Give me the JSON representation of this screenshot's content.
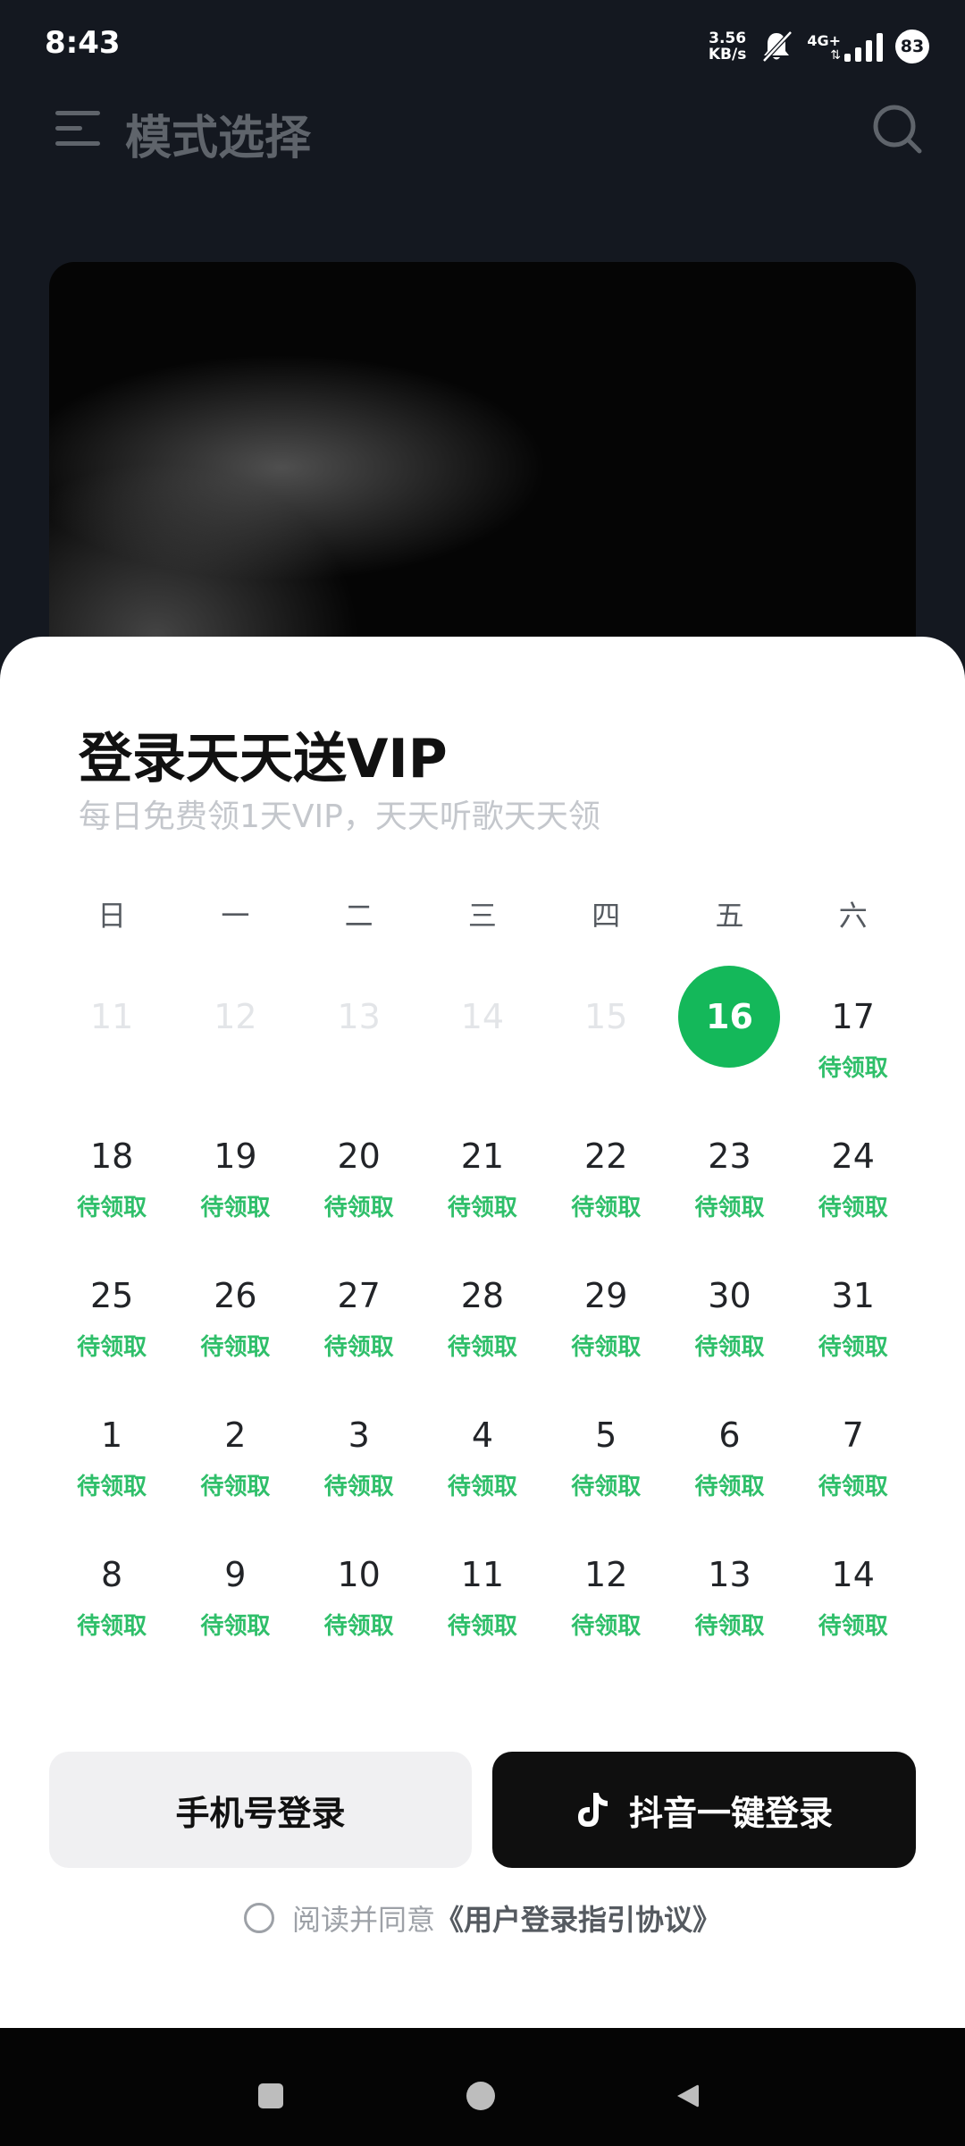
{
  "status_bar": {
    "time": "8:43",
    "net_speed_value": "3.56",
    "net_speed_unit": "KB/s",
    "network_type": "4G+",
    "battery": "83"
  },
  "header": {
    "title": "模式选择",
    "menu_icon": "menu-icon",
    "search_icon": "search-icon"
  },
  "sheet": {
    "title": "登录天天送VIP",
    "subtitle": "每日免费领1天VIP，天天听歌天天领",
    "weekdays": [
      "日",
      "一",
      "二",
      "三",
      "四",
      "五",
      "六"
    ],
    "days": [
      {
        "num": "11",
        "state": "past",
        "tag": ""
      },
      {
        "num": "12",
        "state": "past",
        "tag": ""
      },
      {
        "num": "13",
        "state": "past",
        "tag": ""
      },
      {
        "num": "14",
        "state": "past",
        "tag": ""
      },
      {
        "num": "15",
        "state": "past",
        "tag": ""
      },
      {
        "num": "16",
        "state": "today",
        "tag": ""
      },
      {
        "num": "17",
        "state": "future",
        "tag": "待领取"
      },
      {
        "num": "18",
        "state": "future",
        "tag": "待领取"
      },
      {
        "num": "19",
        "state": "future",
        "tag": "待领取"
      },
      {
        "num": "20",
        "state": "future",
        "tag": "待领取"
      },
      {
        "num": "21",
        "state": "future",
        "tag": "待领取"
      },
      {
        "num": "22",
        "state": "future",
        "tag": "待领取"
      },
      {
        "num": "23",
        "state": "future",
        "tag": "待领取"
      },
      {
        "num": "24",
        "state": "future",
        "tag": "待领取"
      },
      {
        "num": "25",
        "state": "future",
        "tag": "待领取"
      },
      {
        "num": "26",
        "state": "future",
        "tag": "待领取"
      },
      {
        "num": "27",
        "state": "future",
        "tag": "待领取"
      },
      {
        "num": "28",
        "state": "future",
        "tag": "待领取"
      },
      {
        "num": "29",
        "state": "future",
        "tag": "待领取"
      },
      {
        "num": "30",
        "state": "future",
        "tag": "待领取"
      },
      {
        "num": "31",
        "state": "future",
        "tag": "待领取"
      },
      {
        "num": "1",
        "state": "future",
        "tag": "待领取"
      },
      {
        "num": "2",
        "state": "future",
        "tag": "待领取"
      },
      {
        "num": "3",
        "state": "future",
        "tag": "待领取"
      },
      {
        "num": "4",
        "state": "future",
        "tag": "待领取"
      },
      {
        "num": "5",
        "state": "future",
        "tag": "待领取"
      },
      {
        "num": "6",
        "state": "future",
        "tag": "待领取"
      },
      {
        "num": "7",
        "state": "future",
        "tag": "待领取"
      },
      {
        "num": "8",
        "state": "future",
        "tag": "待领取"
      },
      {
        "num": "9",
        "state": "future",
        "tag": "待领取"
      },
      {
        "num": "10",
        "state": "future",
        "tag": "待领取"
      },
      {
        "num": "11",
        "state": "future",
        "tag": "待领取"
      },
      {
        "num": "12",
        "state": "future",
        "tag": "待领取"
      },
      {
        "num": "13",
        "state": "future",
        "tag": "待领取"
      },
      {
        "num": "14",
        "state": "future",
        "tag": "待领取"
      }
    ],
    "phone_login_label": "手机号登录",
    "douyin_login_label": "抖音一键登录",
    "douyin_icon": "douyin-icon",
    "agreement_prefix": "阅读并同意",
    "agreement_link": "《用户登录指引协议》",
    "accent_color": "#14b85a"
  },
  "navbar": {
    "recents_icon": "square-icon",
    "home_icon": "circle-icon",
    "back_icon": "triangle-back-icon"
  }
}
